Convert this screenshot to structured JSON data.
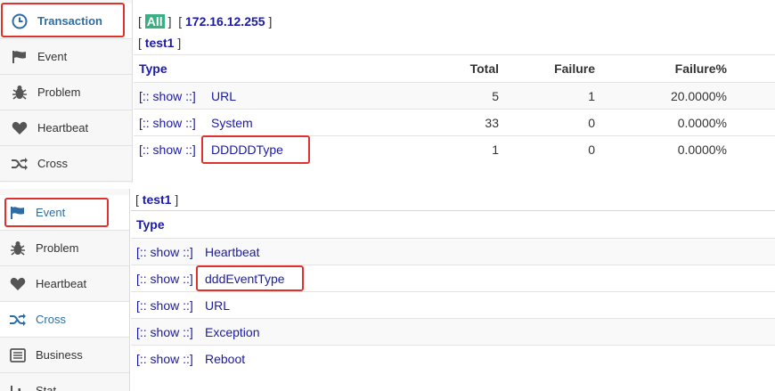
{
  "top_panel": {
    "sidebar": {
      "items": [
        {
          "label": "Transaction",
          "icon": "clock-icon"
        },
        {
          "label": "Event",
          "icon": "flag-icon"
        },
        {
          "label": "Problem",
          "icon": "bug-icon"
        },
        {
          "label": "Heartbeat",
          "icon": "heart-icon"
        },
        {
          "label": "Cross",
          "icon": "shuffle-icon"
        }
      ]
    },
    "filter": {
      "open": "[",
      "all": "All",
      "close": "]",
      "ip_open": "[",
      "ip": "172.16.12.255",
      "ip_close": "]"
    },
    "domain": {
      "open": "[",
      "name": "test1",
      "close": "]"
    },
    "table": {
      "headers": [
        "Type",
        "Total",
        "Failure",
        "Failure%"
      ],
      "rows": [
        {
          "show": "[:: show ::]",
          "type": "URL",
          "total": "5",
          "failure": "1",
          "pct": "20.0000%"
        },
        {
          "show": "[:: show ::]",
          "type": "System",
          "total": "33",
          "failure": "0",
          "pct": "0.0000%"
        },
        {
          "show": "[:: show ::]",
          "type": "DDDDDType",
          "total": "1",
          "failure": "0",
          "pct": "0.0000%"
        }
      ]
    }
  },
  "bottom_panel": {
    "sidebar": {
      "items": [
        {
          "label": "Event",
          "icon": "flag-icon"
        },
        {
          "label": "Problem",
          "icon": "bug-icon"
        },
        {
          "label": "Heartbeat",
          "icon": "heart-icon"
        },
        {
          "label": "Cross",
          "icon": "shuffle-icon"
        },
        {
          "label": "Business",
          "icon": "list-icon"
        },
        {
          "label": "Stat",
          "icon": "chart-icon"
        }
      ]
    },
    "domain": {
      "open": "[",
      "name": "test1",
      "close": "]"
    },
    "table": {
      "headers": [
        "Type"
      ],
      "rows": [
        {
          "show": "[:: show ::]",
          "type": "Heartbeat"
        },
        {
          "show": "[:: show ::]",
          "type": "dddEventType"
        },
        {
          "show": "[:: show ::]",
          "type": "URL"
        },
        {
          "show": "[:: show ::]",
          "type": "Exception"
        },
        {
          "show": "[:: show ::]",
          "type": "Reboot"
        }
      ]
    }
  },
  "colors": {
    "accent": "#2e6da4",
    "link": "#1a1aa6",
    "highlight": "#e0322d",
    "all_tag": "#3cae84"
  }
}
